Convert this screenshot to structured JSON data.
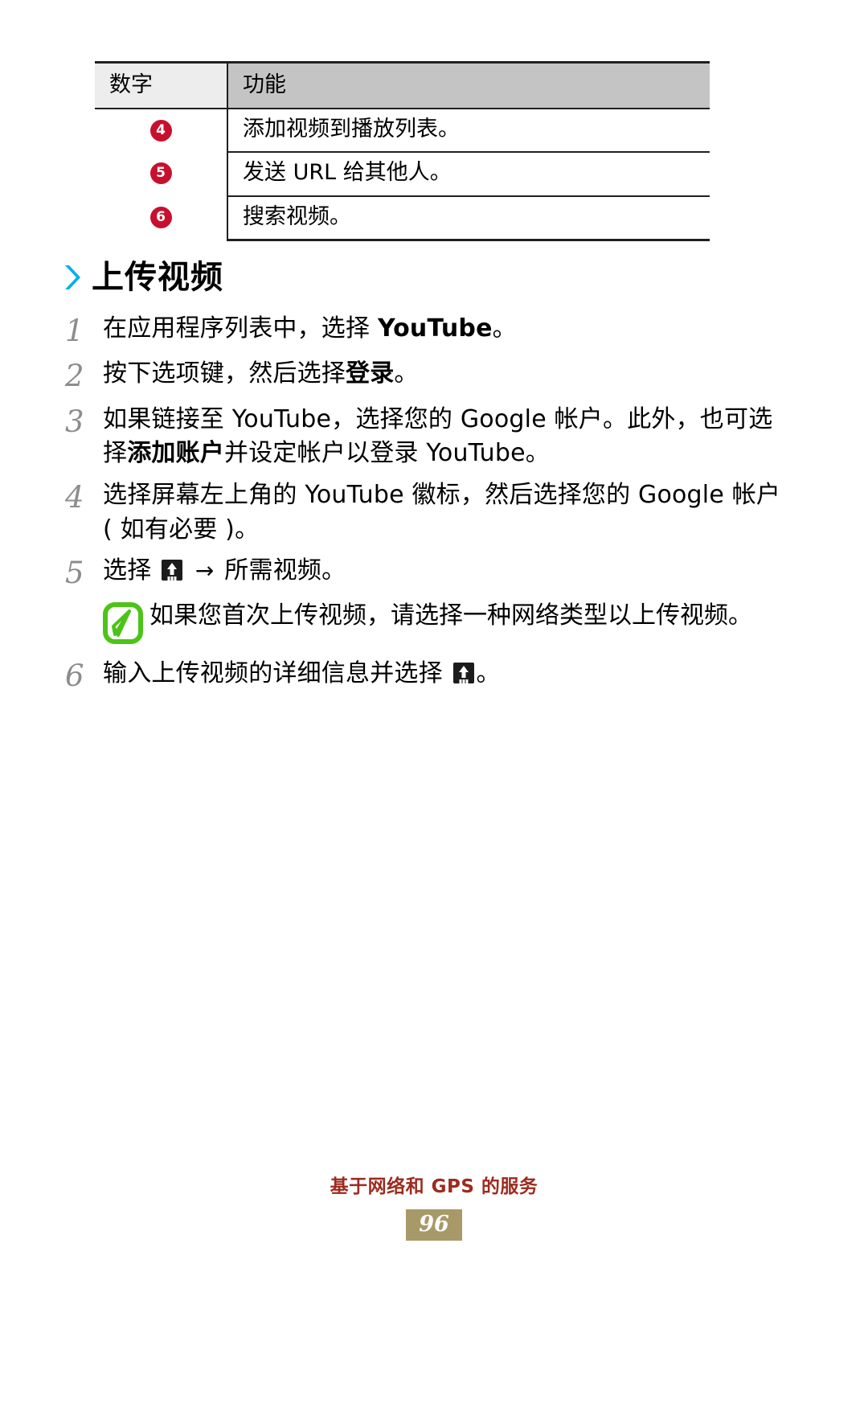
{
  "table": {
    "headers": [
      "数字",
      "功能"
    ],
    "rows": [
      {
        "num": "4",
        "func": "添加视频到播放列表。"
      },
      {
        "num": "5",
        "func": "发送 URL 给其他人。"
      },
      {
        "num": "6",
        "func": "搜索视频。"
      }
    ]
  },
  "section": {
    "marker": "chevron-right-icon",
    "title": "上传视频",
    "accent_color": "#00AEEF"
  },
  "steps": [
    {
      "number": "1",
      "parts": [
        {
          "t": "在应用程序列表中，选择 ",
          "b": false
        },
        {
          "t": "YouTube",
          "b": true
        },
        {
          "t": "。",
          "b": false
        }
      ]
    },
    {
      "number": "2",
      "parts": [
        {
          "t": "按下选项键，然后选择",
          "b": false
        },
        {
          "t": "登录",
          "b": true
        },
        {
          "t": "。",
          "b": false
        }
      ]
    },
    {
      "number": "3",
      "parts": [
        {
          "t": "如果链接至 YouTube，选择您的 Google 帐户。此外，也可选择",
          "b": false
        },
        {
          "t": "添加账户",
          "b": true
        },
        {
          "t": "并设定帐户以登录 YouTube。",
          "b": false
        }
      ]
    },
    {
      "number": "4",
      "parts": [
        {
          "t": "选择屏幕左上角的 YouTube 徽标，然后选择您的 Google 帐户 ( 如有必要 )。",
          "b": false
        }
      ]
    },
    {
      "number": "5",
      "parts": [
        {
          "t": "选择 ",
          "b": false
        },
        {
          "icon": "upload-icon"
        },
        {
          "t": " ",
          "b": false
        },
        {
          "arrow": "→"
        },
        {
          "t": " 所需视频。",
          "b": false
        }
      ]
    },
    {
      "number": "6",
      "parts": [
        {
          "t": "输入上传视频的详细信息并选择 ",
          "b": false
        },
        {
          "icon": "upload-icon"
        },
        {
          "t": "。",
          "b": false
        }
      ]
    }
  ],
  "note": {
    "icon": "note-leaf-icon",
    "icon_color": "#4CC417",
    "text": "如果您首次上传视频，请选择一种网络类型以上传视频。",
    "after_step": "5"
  },
  "footer": {
    "title": "基于网络和 GPS 的服务",
    "title_color": "#9C2B1E",
    "page_number": "96",
    "page_badge_color": "#A89968"
  }
}
